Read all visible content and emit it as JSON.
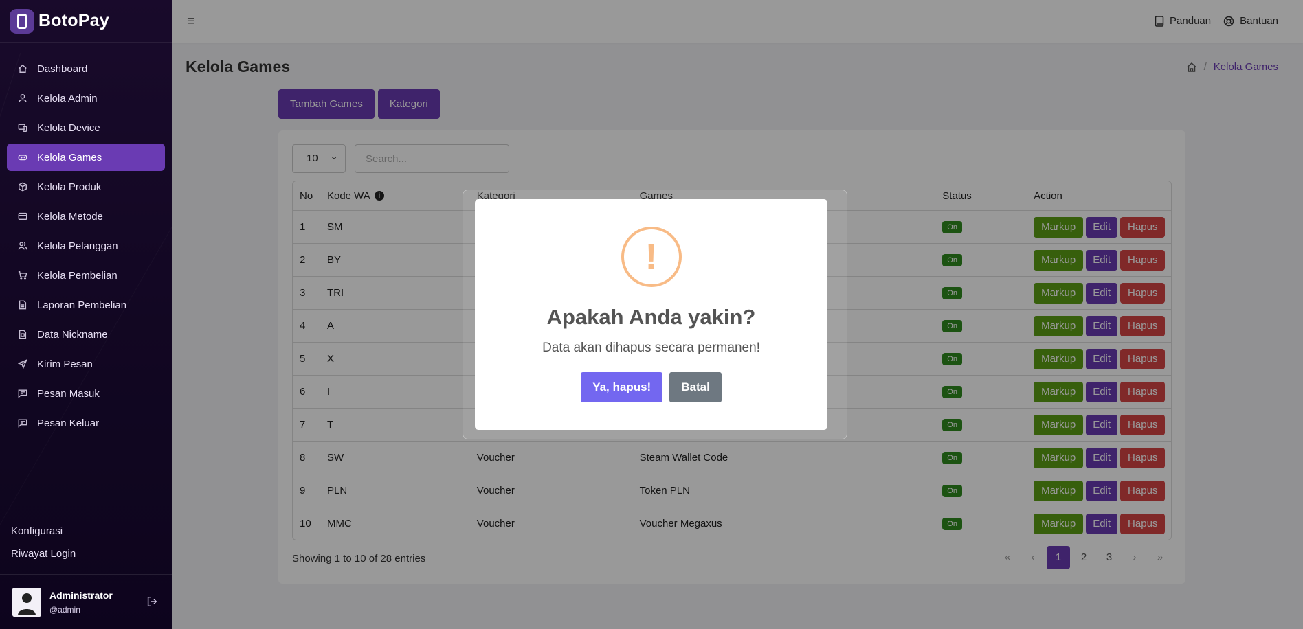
{
  "app": {
    "brand": "BotoPay"
  },
  "sidebar": {
    "items": [
      {
        "label": "Dashboard",
        "icon": "home-icon"
      },
      {
        "label": "Kelola Admin",
        "icon": "user-icon"
      },
      {
        "label": "Kelola Device",
        "icon": "device-icon"
      },
      {
        "label": "Kelola Games",
        "icon": "gamepad-icon",
        "active": true
      },
      {
        "label": "Kelola Produk",
        "icon": "box-icon"
      },
      {
        "label": "Kelola Metode",
        "icon": "credit-card-icon"
      },
      {
        "label": "Kelola Pelanggan",
        "icon": "users-icon"
      },
      {
        "label": "Kelola Pembelian",
        "icon": "cart-icon"
      },
      {
        "label": "Laporan Pembelian",
        "icon": "file-icon"
      },
      {
        "label": "Data Nickname",
        "icon": "id-card-icon"
      },
      {
        "label": "Kirim Pesan",
        "icon": "send-icon"
      },
      {
        "label": "Pesan Masuk",
        "icon": "message-icon"
      },
      {
        "label": "Pesan Keluar",
        "icon": "message-out-icon"
      }
    ],
    "config": [
      "Konfigurasi",
      "Riwayat Login"
    ],
    "user": {
      "name": "Administrator",
      "handle": "@admin"
    }
  },
  "topbar": {
    "panduan": "Panduan",
    "bantuan": "Bantuan"
  },
  "page": {
    "title": "Kelola Games",
    "breadcrumb": "Kelola Games",
    "add_button": "Tambah Games",
    "category_button": "Kategori"
  },
  "table": {
    "length_value": "10",
    "search_placeholder": "Search...",
    "headers": {
      "no": "No",
      "kode": "Kode WA",
      "kategori": "Kategori",
      "games": "Games",
      "status": "Status",
      "action": "Action"
    },
    "rows": [
      {
        "no": "1",
        "kode": "SM",
        "kategori": "",
        "games": "",
        "status": "On"
      },
      {
        "no": "2",
        "kode": "BY",
        "kategori": "",
        "games": "",
        "status": "On"
      },
      {
        "no": "3",
        "kode": "TRI",
        "kategori": "",
        "games": "",
        "status": "On"
      },
      {
        "no": "4",
        "kode": "A",
        "kategori": "",
        "games": "",
        "status": "On"
      },
      {
        "no": "5",
        "kode": "X",
        "kategori": "",
        "games": "",
        "status": "On"
      },
      {
        "no": "6",
        "kode": "I",
        "kategori": "",
        "games": "",
        "status": "On"
      },
      {
        "no": "7",
        "kode": "T",
        "kategori": "",
        "games": "",
        "status": "On"
      },
      {
        "no": "8",
        "kode": "SW",
        "kategori": "Voucher",
        "games": "Steam Wallet Code",
        "status": "On"
      },
      {
        "no": "9",
        "kode": "PLN",
        "kategori": "Voucher",
        "games": "Token PLN",
        "status": "On"
      },
      {
        "no": "10",
        "kode": "MMC",
        "kategori": "Voucher",
        "games": "Voucher Megaxus",
        "status": "On"
      }
    ],
    "actions": {
      "markup": "Markup",
      "edit": "Edit",
      "hapus": "Hapus"
    },
    "showing": "Showing 1 to 10 of 28 entries",
    "pagination": [
      "«",
      "‹",
      "1",
      "2",
      "3",
      "›",
      "»"
    ],
    "current_page": "1"
  },
  "modal": {
    "icon": "!",
    "title": "Apakah Anda yakin?",
    "text": "Data akan dihapus secara permanen!",
    "confirm": "Ya, hapus!",
    "cancel": "Batal"
  },
  "colors": {
    "primary": "#6a3bb3",
    "success": "#5c9f14",
    "danger": "#d64545",
    "warning": "#f8bb86"
  }
}
